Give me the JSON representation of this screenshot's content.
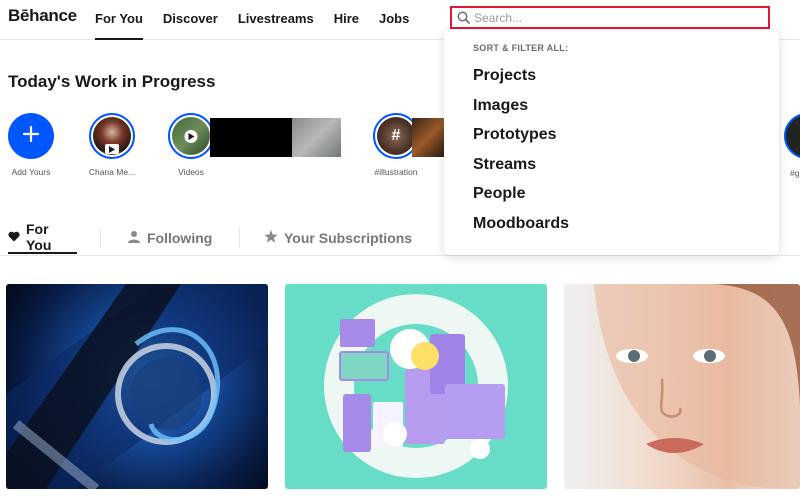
{
  "brand": {
    "logo": "Bēhance"
  },
  "nav": {
    "items": [
      {
        "label": "For You",
        "active": true
      },
      {
        "label": "Discover",
        "active": false
      },
      {
        "label": "Livestreams",
        "active": false
      },
      {
        "label": "Hire",
        "active": false
      },
      {
        "label": "Jobs",
        "active": false
      }
    ]
  },
  "search": {
    "placeholder": "Search...",
    "value": ""
  },
  "dropdown": {
    "heading": "SORT & FILTER ALL:",
    "options": [
      "Projects",
      "Images",
      "Prototypes",
      "Streams",
      "People",
      "Moodboards"
    ]
  },
  "wip": {
    "title": "Today's Work in Progress",
    "stories": [
      {
        "label": "Add Yours"
      },
      {
        "label": "Chana Me..."
      },
      {
        "label": "Videos"
      },
      {
        "label": "#illustration"
      },
      {
        "label": "#g"
      }
    ]
  },
  "feed_tabs": [
    {
      "label": "For You",
      "icon": "heart-icon",
      "active": true
    },
    {
      "label": "Following",
      "icon": "person-icon",
      "active": false
    },
    {
      "label": "Your Subscriptions",
      "icon": "star-icon",
      "active": false
    }
  ],
  "colors": {
    "accent": "#0057ff",
    "highlight": "#e0182f",
    "text": "#191919"
  }
}
